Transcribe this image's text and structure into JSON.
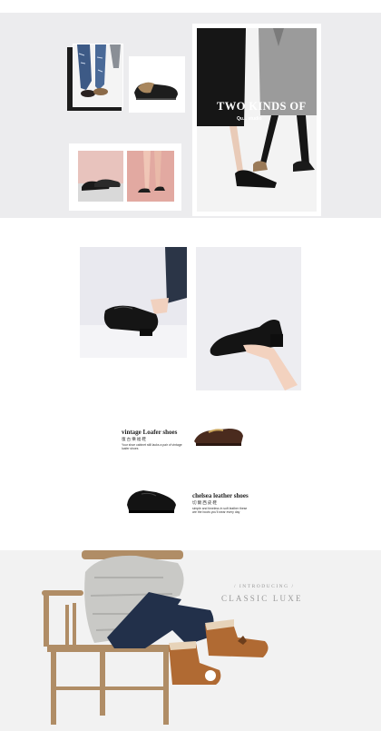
{
  "hero": {
    "title": "TWO KINDS OF",
    "subtitle": "Qu... studio"
  },
  "products": [
    {
      "title": "vintage Loafer shoes",
      "subtitle_cn": "復古樂福鞋",
      "desc": "Your shoe cabinet still lacks a pair of vintage loafer shoes"
    },
    {
      "title": "chelsea leather shoes",
      "subtitle_cn": "切爾西皮鞋",
      "desc": "simple and timeless in soft leather these are the boots you'll wear every day"
    }
  ],
  "banner": {
    "intro": "/ INTRODUCING /",
    "title": "CLASSIC LUXE"
  },
  "colors": {
    "top_bg": "#ececee",
    "banner_bg": "#f2f2f2",
    "text_dark": "#222222",
    "text_grey": "#9a9a9a"
  }
}
